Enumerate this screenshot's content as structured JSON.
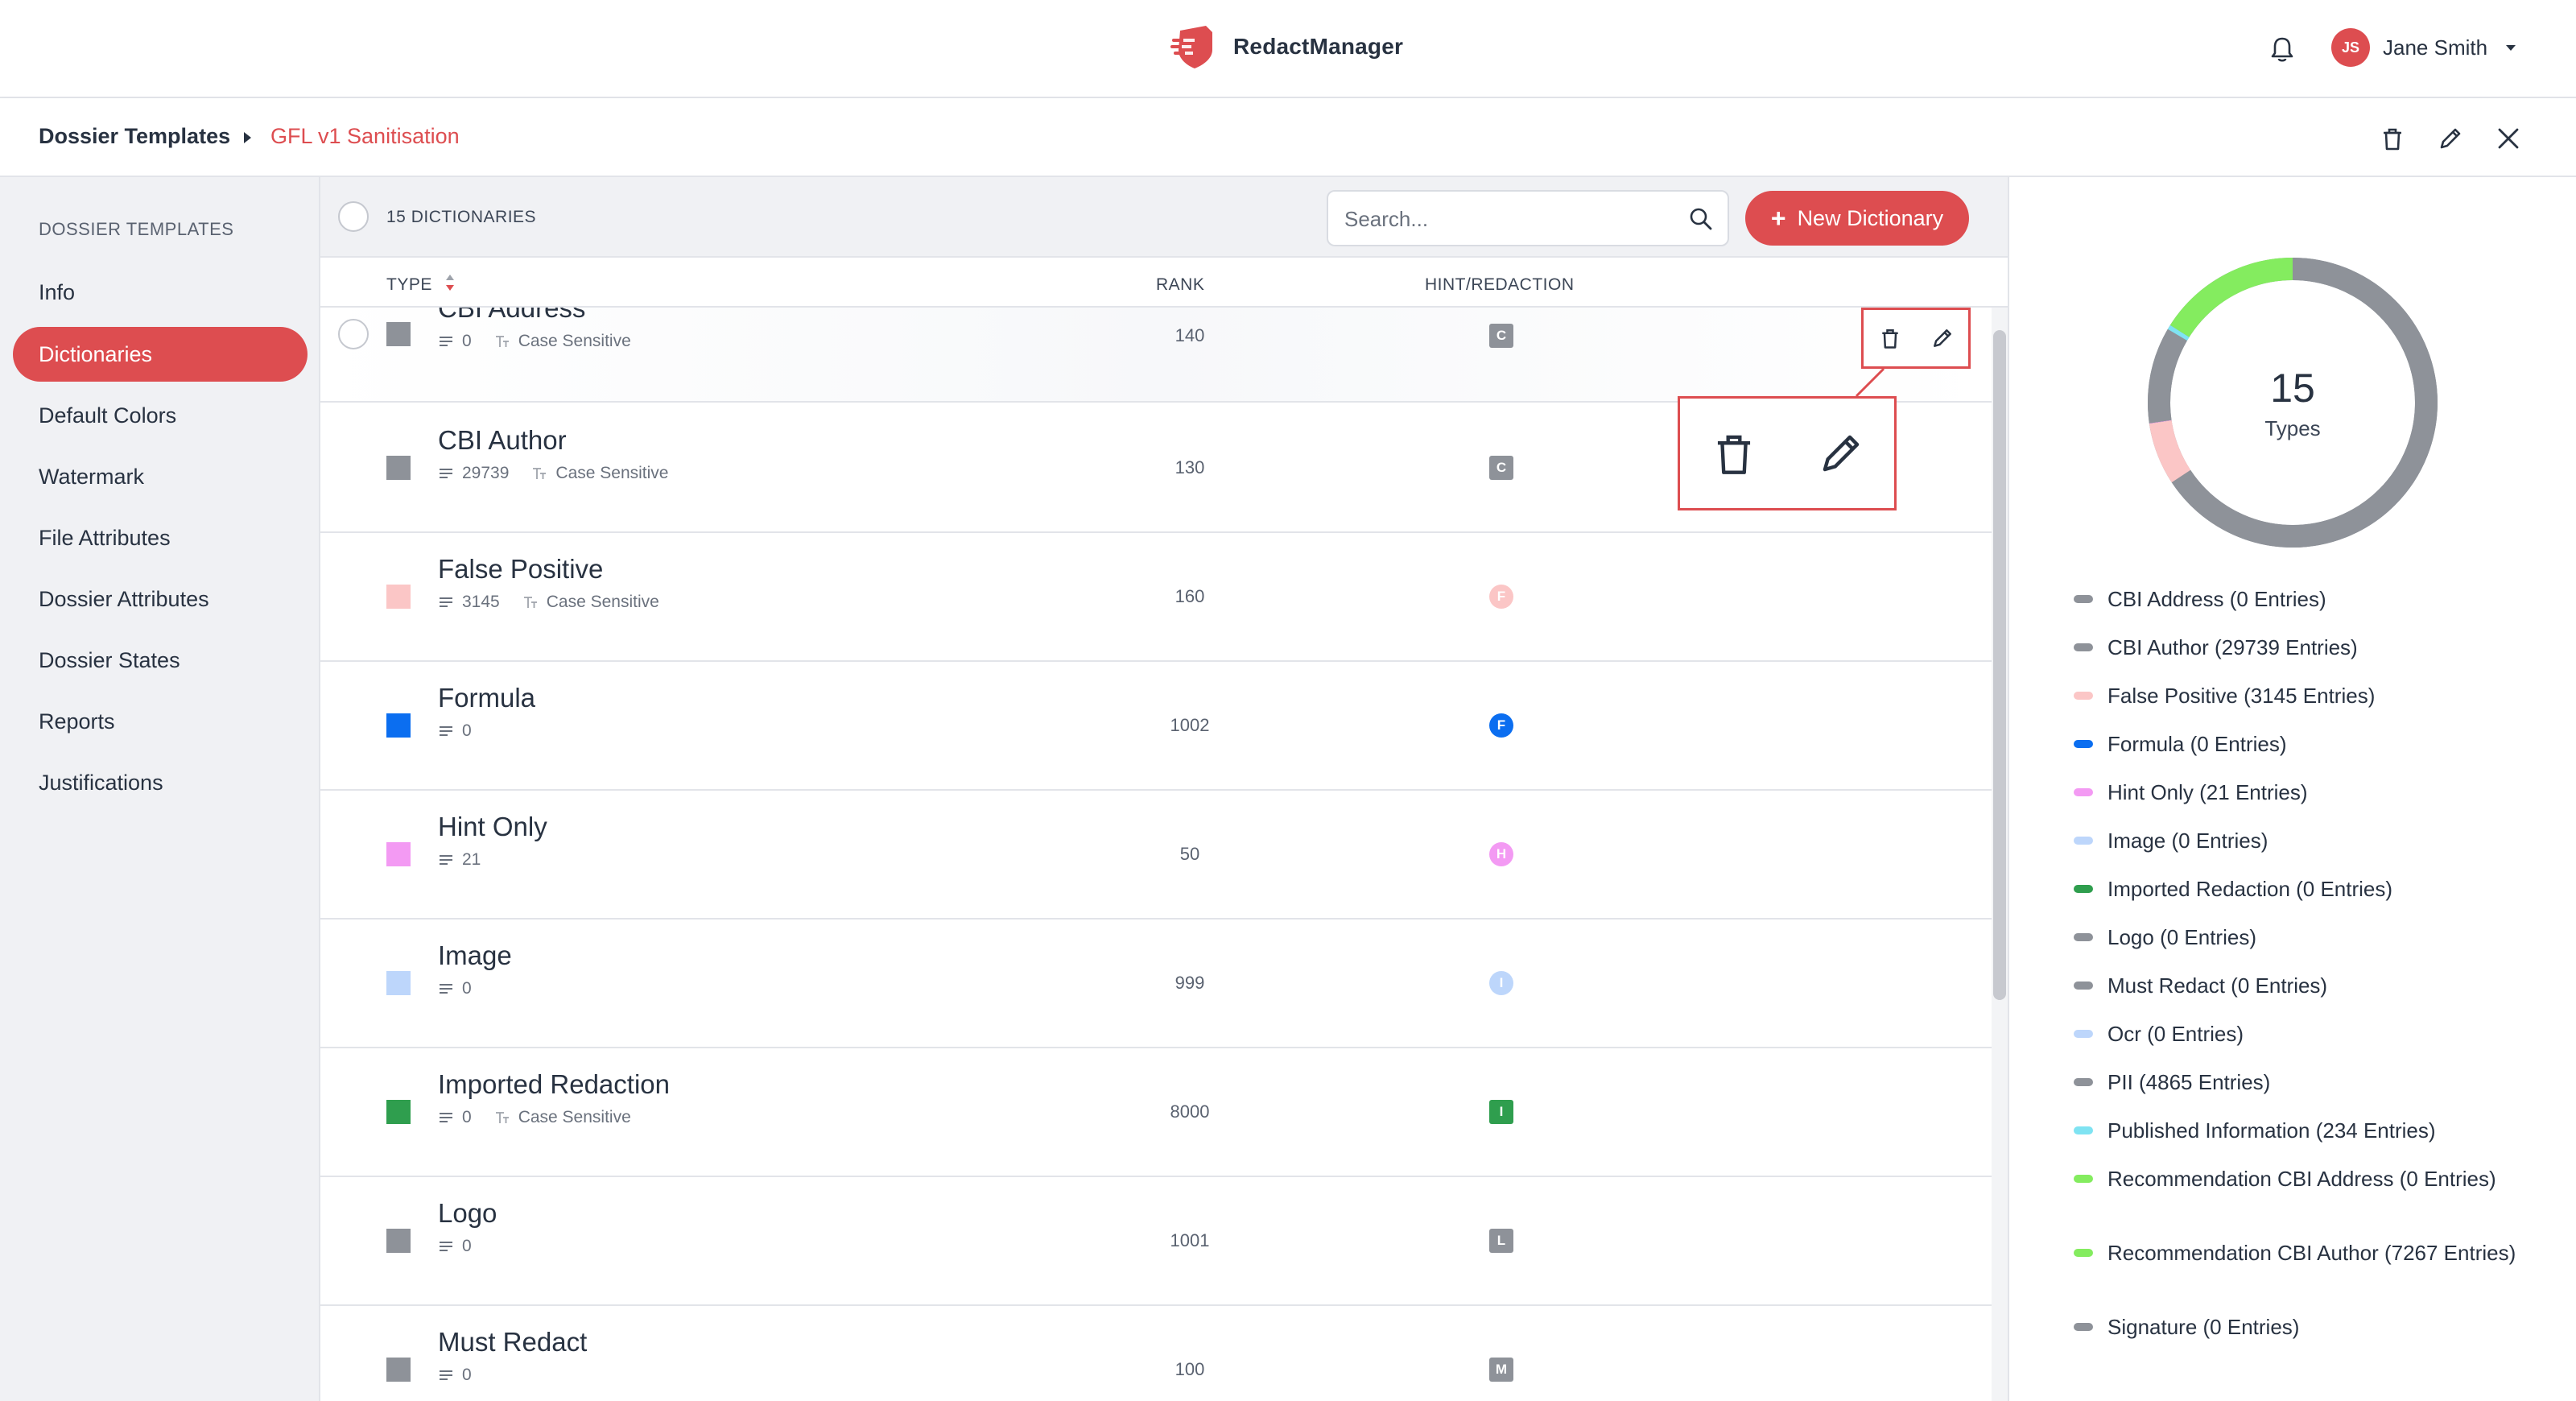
{
  "app": {
    "name": "RedactManager"
  },
  "user": {
    "initials": "JS",
    "name": "Jane Smith"
  },
  "breadcrumb": {
    "root": "Dossier Templates",
    "current": "GFL v1 Sanitisation"
  },
  "sidebar": {
    "heading": "DOSSIER TEMPLATES",
    "items": [
      {
        "label": "Info",
        "active": false
      },
      {
        "label": "Dictionaries",
        "active": true
      },
      {
        "label": "Default Colors",
        "active": false
      },
      {
        "label": "Watermark",
        "active": false
      },
      {
        "label": "File Attributes",
        "active": false
      },
      {
        "label": "Dossier Attributes",
        "active": false
      },
      {
        "label": "Dossier States",
        "active": false
      },
      {
        "label": "Reports",
        "active": false
      },
      {
        "label": "Justifications",
        "active": false
      }
    ]
  },
  "list": {
    "count_label": "15 DICTIONARIES",
    "search_placeholder": "Search...",
    "new_button": "New Dictionary",
    "columns": {
      "type": "TYPE",
      "rank": "RANK",
      "hint": "HINT/REDACTION"
    }
  },
  "dictionaries": [
    {
      "name": "CBI Address",
      "entries": "0",
      "case": "Case Sensitive",
      "rank": "140",
      "badge": "C",
      "shape": "sq",
      "color": "#8e9299"
    },
    {
      "name": "CBI Author",
      "entries": "29739",
      "case": "Case Sensitive",
      "rank": "130",
      "badge": "C",
      "shape": "sq",
      "color": "#8e9299"
    },
    {
      "name": "False Positive",
      "entries": "3145",
      "case": "Case Sensitive",
      "rank": "160",
      "badge": "F",
      "shape": "round",
      "color": "#fbc6c6"
    },
    {
      "name": "Formula",
      "entries": "0",
      "case": "",
      "rank": "1002",
      "badge": "F",
      "shape": "round",
      "color": "#0b6ef0"
    },
    {
      "name": "Hint Only",
      "entries": "21",
      "case": "",
      "rank": "50",
      "badge": "H",
      "shape": "round",
      "color": "#f39af3"
    },
    {
      "name": "Image",
      "entries": "0",
      "case": "",
      "rank": "999",
      "badge": "I",
      "shape": "round",
      "color": "#bdd6fb"
    },
    {
      "name": "Imported Redaction",
      "entries": "0",
      "case": "Case Sensitive",
      "rank": "8000",
      "badge": "I",
      "shape": "sq",
      "color": "#2f9e4e"
    },
    {
      "name": "Logo",
      "entries": "0",
      "case": "",
      "rank": "1001",
      "badge": "L",
      "shape": "sq",
      "color": "#8e9299"
    },
    {
      "name": "Must Redact",
      "entries": "0",
      "case": "",
      "rank": "100",
      "badge": "M",
      "shape": "sq",
      "color": "#8e9299"
    }
  ],
  "summary": {
    "count": "15",
    "label": "Types"
  },
  "legend": [
    {
      "label": "CBI Address (0 Entries)",
      "color": "#8e9299"
    },
    {
      "label": "CBI Author (29739 Entries)",
      "color": "#8e9299"
    },
    {
      "label": "False Positive (3145 Entries)",
      "color": "#fbc6c6"
    },
    {
      "label": "Formula (0 Entries)",
      "color": "#0b6ef0"
    },
    {
      "label": "Hint Only (21 Entries)",
      "color": "#f39af3"
    },
    {
      "label": "Image (0 Entries)",
      "color": "#bdd6fb"
    },
    {
      "label": "Imported Redaction (0 Entries)",
      "color": "#2f9e4e"
    },
    {
      "label": "Logo (0 Entries)",
      "color": "#8e9299"
    },
    {
      "label": "Must Redact (0 Entries)",
      "color": "#8e9299"
    },
    {
      "label": "Ocr (0 Entries)",
      "color": "#bdd6fb"
    },
    {
      "label": "PII (4865 Entries)",
      "color": "#8e9299"
    },
    {
      "label": "Published Information (234 Entries)",
      "color": "#7fe3f2"
    },
    {
      "label": "Recommendation CBI Address (0 Entries)",
      "color": "#84ec5f"
    },
    {
      "label": "Recommendation CBI Author (7267 Entries)",
      "color": "#84ec5f"
    },
    {
      "label": "Signature (0 Entries)",
      "color": "#8e9299"
    }
  ],
  "donut_segments": [
    {
      "color": "#8e9299",
      "value": 29739
    },
    {
      "color": "#fbc6c6",
      "value": 3145
    },
    {
      "color": "#f39af3",
      "value": 21
    },
    {
      "color": "#8e9299",
      "value": 4865
    },
    {
      "color": "#7fe3f2",
      "value": 234
    },
    {
      "color": "#84ec5f",
      "value": 7267
    }
  ]
}
